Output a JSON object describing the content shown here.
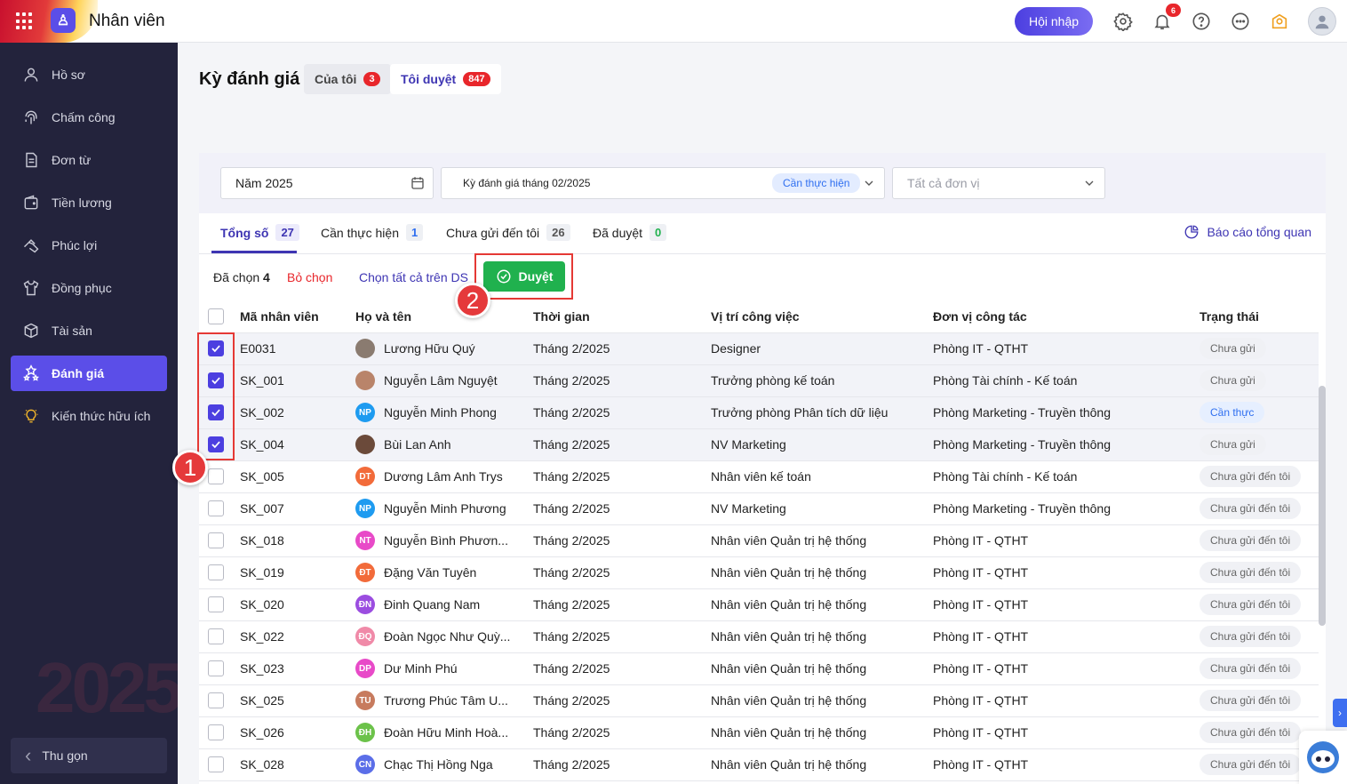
{
  "topbar": {
    "app_title": "Nhân viên",
    "join_label": "Hội nhập",
    "notification_count": "6",
    "icons": [
      "apps-grid-icon",
      "settings-icon",
      "bell-icon",
      "help-icon",
      "more-icon",
      "idea-icon",
      "avatar"
    ]
  },
  "sidebar": {
    "items": [
      {
        "label": "Hồ sơ",
        "icon": "user-icon"
      },
      {
        "label": "Chấm công",
        "icon": "fingerprint-icon"
      },
      {
        "label": "Đơn từ",
        "icon": "document-icon"
      },
      {
        "label": "Tiền lương",
        "icon": "wallet-icon"
      },
      {
        "label": "Phúc lợi",
        "icon": "benefit-icon"
      },
      {
        "label": "Đồng phục",
        "icon": "shirt-icon"
      },
      {
        "label": "Tài sản",
        "icon": "box-icon"
      },
      {
        "label": "Đánh giá",
        "icon": "stars-icon",
        "active": true
      },
      {
        "label": "Kiến thức hữu ích",
        "icon": "bulb-icon"
      }
    ],
    "collapse_label": "Thu gọn"
  },
  "page": {
    "title": "Kỳ đánh giá",
    "tabs": [
      {
        "label": "Của tôi",
        "count": "3"
      },
      {
        "label": "Tôi duyệt",
        "count": "847",
        "active": true
      }
    ]
  },
  "filters": {
    "year": "Năm 2025",
    "period": "Kỳ đánh giá tháng 02/2025",
    "period_status": "Cần thực hiện",
    "unit_placeholder": "Tất cả đơn vị"
  },
  "subtabs": [
    {
      "label": "Tổng số",
      "count": "27",
      "active": true
    },
    {
      "label": "Cần thực hiện",
      "count": "1"
    },
    {
      "label": "Chưa gửi đến tôi",
      "count": "26"
    },
    {
      "label": "Đã duyệt",
      "count": "0"
    }
  ],
  "report_link": "Báo cáo tổng quan",
  "actions": {
    "selected_prefix": "Đã chọn",
    "selected_count": "4",
    "unselect": "Bỏ chọn",
    "select_all": "Chọn tất cả trên DS",
    "approve": "Duyệt"
  },
  "table": {
    "headers": [
      "Mã nhân viên",
      "Họ và tên",
      "Thời gian",
      "Vị trí công việc",
      "Đơn vị công tác",
      "Trạng thái"
    ],
    "rows": [
      {
        "id": "E0031",
        "name": "Lương Hữu Quý",
        "initials": "",
        "avatar_color": "#8a7b70",
        "time": "Tháng 2/2025",
        "position": "Designer",
        "unit": "Phòng IT - QTHT",
        "status": "Chưa gửi",
        "status_type": "normal",
        "checked": true
      },
      {
        "id": "SK_001",
        "name": "Nguyễn Lâm Nguyệt",
        "initials": "",
        "avatar_color": "#b9846a",
        "time": "Tháng 2/2025",
        "position": "Trưởng phòng kế toán",
        "unit": "Phòng Tài chính - Kế toán",
        "status": "Chưa gửi",
        "status_type": "normal",
        "checked": true
      },
      {
        "id": "SK_002",
        "name": "Nguyễn Minh Phong",
        "initials": "NP",
        "avatar_color": "#1e9bf0",
        "time": "Tháng 2/2025",
        "position": "Trưởng phòng Phân tích dữ liệu",
        "unit": "Phòng Marketing - Truyền thông",
        "status": "Cần thực",
        "status_type": "todo",
        "checked": true
      },
      {
        "id": "SK_004",
        "name": "Bùi Lan Anh",
        "initials": "",
        "avatar_color": "#6b4a3a",
        "time": "Tháng 2/2025",
        "position": "NV Marketing",
        "unit": "Phòng Marketing - Truyền thông",
        "status": "Chưa gửi",
        "status_type": "normal",
        "checked": true
      },
      {
        "id": "SK_005",
        "name": "Dương Lâm Anh Trys",
        "initials": "DT",
        "avatar_color": "#f26b3a",
        "time": "Tháng 2/2025",
        "position": "Nhân viên kế toán",
        "unit": "Phòng Tài chính - Kế toán",
        "status": "Chưa gửi đến tôi",
        "status_type": "normal",
        "checked": false
      },
      {
        "id": "SK_007",
        "name": "Nguyễn Minh Phương",
        "initials": "NP",
        "avatar_color": "#1e9bf0",
        "time": "Tháng 2/2025",
        "position": "NV Marketing",
        "unit": "Phòng Marketing - Truyền thông",
        "status": "Chưa gửi đến tôi",
        "status_type": "normal",
        "checked": false
      },
      {
        "id": "SK_018",
        "name": "Nguyễn Bình Phươn...",
        "initials": "NT",
        "avatar_color": "#e84ac8",
        "time": "Tháng 2/2025",
        "position": "Nhân viên Quản trị hệ thống",
        "unit": "Phòng IT - QTHT",
        "status": "Chưa gửi đến tôi",
        "status_type": "normal",
        "checked": false
      },
      {
        "id": "SK_019",
        "name": "Đặng Văn Tuyên",
        "initials": "ĐT",
        "avatar_color": "#f26b3a",
        "time": "Tháng 2/2025",
        "position": "Nhân viên Quản trị hệ thống",
        "unit": "Phòng IT - QTHT",
        "status": "Chưa gửi đến tôi",
        "status_type": "normal",
        "checked": false
      },
      {
        "id": "SK_020",
        "name": "Đinh Quang Nam",
        "initials": "ĐN",
        "avatar_color": "#9b4de0",
        "time": "Tháng 2/2025",
        "position": "Nhân viên Quản trị hệ thống",
        "unit": "Phòng IT - QTHT",
        "status": "Chưa gửi đến tôi",
        "status_type": "normal",
        "checked": false
      },
      {
        "id": "SK_022",
        "name": "Đoàn Ngọc Như Quỳ...",
        "initials": "ĐQ",
        "avatar_color": "#f08aa8",
        "time": "Tháng 2/2025",
        "position": "Nhân viên Quản trị hệ thống",
        "unit": "Phòng IT - QTHT",
        "status": "Chưa gửi đến tôi",
        "status_type": "normal",
        "checked": false
      },
      {
        "id": "SK_023",
        "name": "Dư Minh Phú",
        "initials": "DP",
        "avatar_color": "#e84ac8",
        "time": "Tháng 2/2025",
        "position": "Nhân viên Quản trị hệ thống",
        "unit": "Phòng IT - QTHT",
        "status": "Chưa gửi đến tôi",
        "status_type": "normal",
        "checked": false
      },
      {
        "id": "SK_025",
        "name": "Trương Phúc Tâm U...",
        "initials": "TU",
        "avatar_color": "#c77b5e",
        "time": "Tháng 2/2025",
        "position": "Nhân viên Quản trị hệ thống",
        "unit": "Phòng IT - QTHT",
        "status": "Chưa gửi đến tôi",
        "status_type": "normal",
        "checked": false
      },
      {
        "id": "SK_026",
        "name": "Đoàn Hữu Minh Hoà...",
        "initials": "ĐH",
        "avatar_color": "#6cc24a",
        "time": "Tháng 2/2025",
        "position": "Nhân viên Quản trị hệ thống",
        "unit": "Phòng IT - QTHT",
        "status": "Chưa gửi đến tôi",
        "status_type": "normal",
        "checked": false
      },
      {
        "id": "SK_028",
        "name": "Chạc Thị Hồng Nga",
        "initials": "CN",
        "avatar_color": "#5b6ee8",
        "time": "Tháng 2/2025",
        "position": "Nhân viên Quản trị hệ thống",
        "unit": "Phòng IT - QTHT",
        "status": "Chưa gửi đến tôi",
        "status_type": "normal",
        "checked": false
      }
    ]
  },
  "annotations": {
    "step1": "1",
    "step2": "2"
  }
}
